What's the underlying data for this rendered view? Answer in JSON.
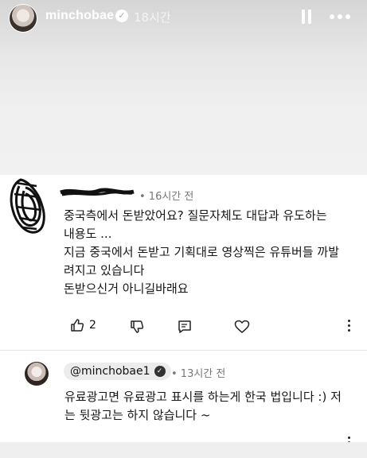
{
  "story": {
    "username": "minchobae",
    "time_ago": "18시간",
    "icons": {
      "verified": "verified-badge-icon",
      "pause": "pause-icon",
      "more": "more-icon"
    }
  },
  "comment": {
    "time_ago": "• 16시간 전",
    "lines": [
      "중국측에서 돈받았어요? 질문자체도 대답과 유도하는",
      "내용도 ...",
      "지금 중국에서 돈받고 기획대로 영상찍은 유튜버들 까발",
      "려지고 있습니다",
      "돈받으신거 아니길바래요"
    ],
    "like_count": "2",
    "icons": [
      "thumbs-up-icon",
      "thumbs-down-icon",
      "reply-icon",
      "heart-icon",
      "more-vertical-icon"
    ]
  },
  "reply": {
    "mention": "@minchobae1",
    "time_ago": "• 13시간 전",
    "lines": [
      "유료광고면 유료광고 표시를 하는게 한국 법입니다 :) 저",
      "는 뒷광고는 하지 않습니다 ~"
    ]
  },
  "colors": {
    "text": "#161616",
    "meta": "#777777",
    "pill": "#ececec",
    "header_bg": "#d5d5d5"
  }
}
